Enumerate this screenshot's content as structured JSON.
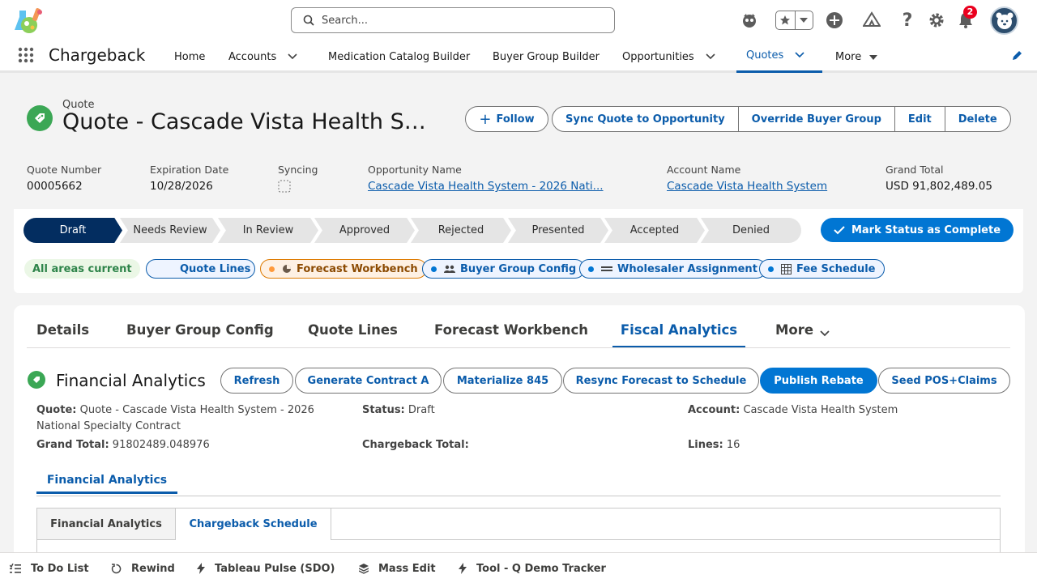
{
  "search": {
    "placeholder": "Search..."
  },
  "notifications": {
    "count": "2"
  },
  "nav": {
    "app_name": "Chargeback",
    "items": [
      {
        "label": "Home"
      },
      {
        "label": "Accounts"
      },
      {
        "label": "Medication Catalog Builder"
      },
      {
        "label": "Buyer Group Builder"
      },
      {
        "label": "Opportunities"
      },
      {
        "label": "Quotes"
      },
      {
        "label": "More"
      }
    ]
  },
  "record": {
    "type": "Quote",
    "title": "Quote - Cascade Vista Health System - 2026 National Specialty Contract",
    "actions": {
      "follow": "Follow",
      "sync": "Sync Quote to Opportunity",
      "override": "Override Buyer Group",
      "edit": "Edit",
      "delete": "Delete"
    },
    "fields": {
      "quote_number_label": "Quote Number",
      "quote_number": "00005662",
      "expiration_label": "Expiration Date",
      "expiration": "10/28/2026",
      "syncing_label": "Syncing",
      "opportunity_label": "Opportunity Name",
      "opportunity": "Cascade Vista Health System - 2026 Nati...",
      "account_label": "Account Name",
      "account": "Cascade Vista Health System",
      "grand_total_label": "Grand Total",
      "grand_total": "USD 91,802,489.05"
    }
  },
  "path": {
    "stages": [
      "Draft",
      "Needs Review",
      "In Review",
      "Approved",
      "Rejected",
      "Presented",
      "Accepted",
      "Denied"
    ],
    "current": "Draft",
    "mark_complete": "Mark Status as Complete"
  },
  "areas": {
    "status": "All areas current",
    "chips": [
      "Quote Lines",
      "Forecast Workbench",
      "Buyer Group Config",
      "Wholesaler Assignment",
      "Fee Schedule"
    ]
  },
  "tabs": {
    "items": [
      "Details",
      "Buyer Group Config",
      "Quote Lines",
      "Forecast Workbench",
      "Fiscal Analytics",
      "More"
    ],
    "active": "Fiscal Analytics"
  },
  "analytics": {
    "title": "Financial Analytics",
    "buttons": {
      "refresh": "Refresh",
      "generate": "Generate Contract A",
      "materialize": "Materialize 845",
      "resync": "Resync Forecast to Schedule",
      "publish": "Publish Rebate",
      "seed": "Seed POS+Claims"
    },
    "info": {
      "quote_label": "Quote:",
      "quote": "Quote - Cascade Vista Health System - 2026 National Specialty Contract",
      "status_label": "Status:",
      "status": "Draft",
      "account_label": "Account:",
      "account": "Cascade Vista Health System",
      "grand_total_label": "Grand Total:",
      "grand_total": "91802489.048976",
      "chargeback_total_label": "Chargeback Total:",
      "chargeback_total": "",
      "lines_label": "Lines:",
      "lines": "16"
    },
    "subtab": "Financial Analytics",
    "box_tabs": [
      "Financial Analytics",
      "Chargeback Schedule"
    ]
  },
  "utility": [
    "To Do List",
    "Rewind",
    "Tableau Pulse (SDO)",
    "Mass Edit",
    "Tool - Q Demo Tracker"
  ]
}
